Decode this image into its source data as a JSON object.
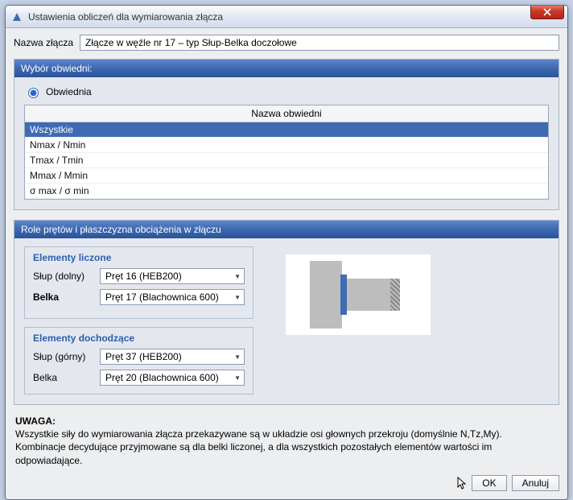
{
  "window": {
    "title": "Ustawienia obliczeń dla wymiarowania złącza"
  },
  "connectionName": {
    "label": "Nazwa złącza",
    "value": "Złącze w węźle nr 17 – typ Słup-Belka doczołowe"
  },
  "envelope": {
    "panelTitle": "Wybór obwiedni:",
    "radioLabel": "Obwiednia",
    "columnHeader": "Nazwa obwiedni",
    "rows": [
      "Wszystkie",
      "Nmax / Nmin",
      "Tmax / Tmin",
      "Mmax / Mmin",
      "σ max / σ min"
    ],
    "selectedIndex": 0
  },
  "roles": {
    "panelTitle": "Role prętów i płaszczyzna obciążenia w złączu",
    "counted": {
      "legend": "Elementy liczone",
      "colBottomLabel": "Słup (dolny)",
      "colBottomValue": "Pręt 16 (HEB200)",
      "beamLabel": "Belka",
      "beamValue": "Pręt 17 (Blachownica 600)"
    },
    "arriving": {
      "legend": "Elementy dochodzące",
      "colTopLabel": "Słup (górny)",
      "colTopValue": "Pręt 37 (HEB200)",
      "beamLabel": "Belka",
      "beamValue": "Pręt 20 (Blachownica 600)"
    }
  },
  "note": {
    "title": "UWAGA:",
    "line1": "Wszystkie siły do wymiarowania złącza przekazywane są w układzie osi głownych przekroju (domyślnie N,Tz,My).",
    "line2": "Kombinacje decydujące przyjmowane są dla belki liczonej, a dla wszystkich pozostałych elementów wartości im odpowiadające."
  },
  "buttons": {
    "ok": "OK",
    "cancel": "Anuluj"
  }
}
